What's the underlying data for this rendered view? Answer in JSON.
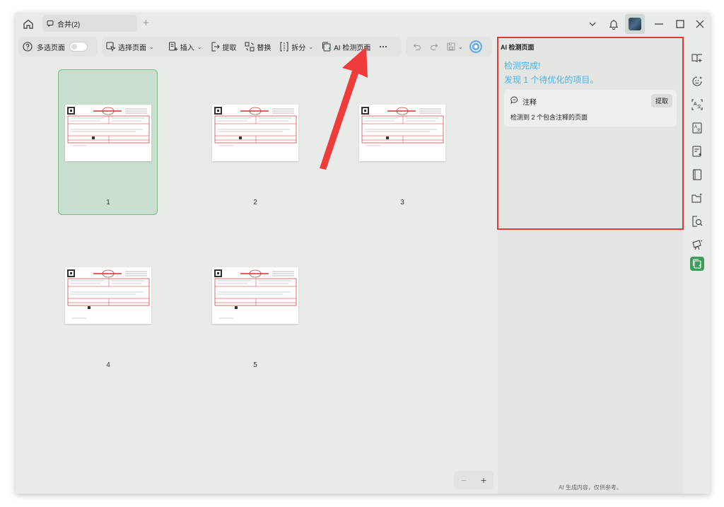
{
  "titlebar": {
    "tab_label": "合并(2)"
  },
  "toolbar": {
    "multi_select_label": "多选页面",
    "select_page_label": "选择页面",
    "insert_label": "插入",
    "extract_label": "提取",
    "replace_label": "替换",
    "split_label": "拆分",
    "ai_detect_label": "AI 检测页面",
    "more_label": "···"
  },
  "pages": [
    {
      "number": "1"
    },
    {
      "number": "2"
    },
    {
      "number": "3"
    },
    {
      "number": "4"
    },
    {
      "number": "5"
    }
  ],
  "zoom": {
    "minus": "−",
    "plus": "+"
  },
  "panel": {
    "title": "AI 检测页面",
    "status_line1": "检测完成!",
    "status_line2": "发现 1 个待优化的项目。",
    "card": {
      "label": "注释",
      "action": "提取",
      "description": "检测到 2 个包含注释的页面"
    },
    "footer": "AI 生成内容，仅供参考。"
  },
  "colors": {
    "accent_blue": "#4ab0e8",
    "selected_green": "#3c9e5c",
    "highlight_red": "#e53935"
  }
}
